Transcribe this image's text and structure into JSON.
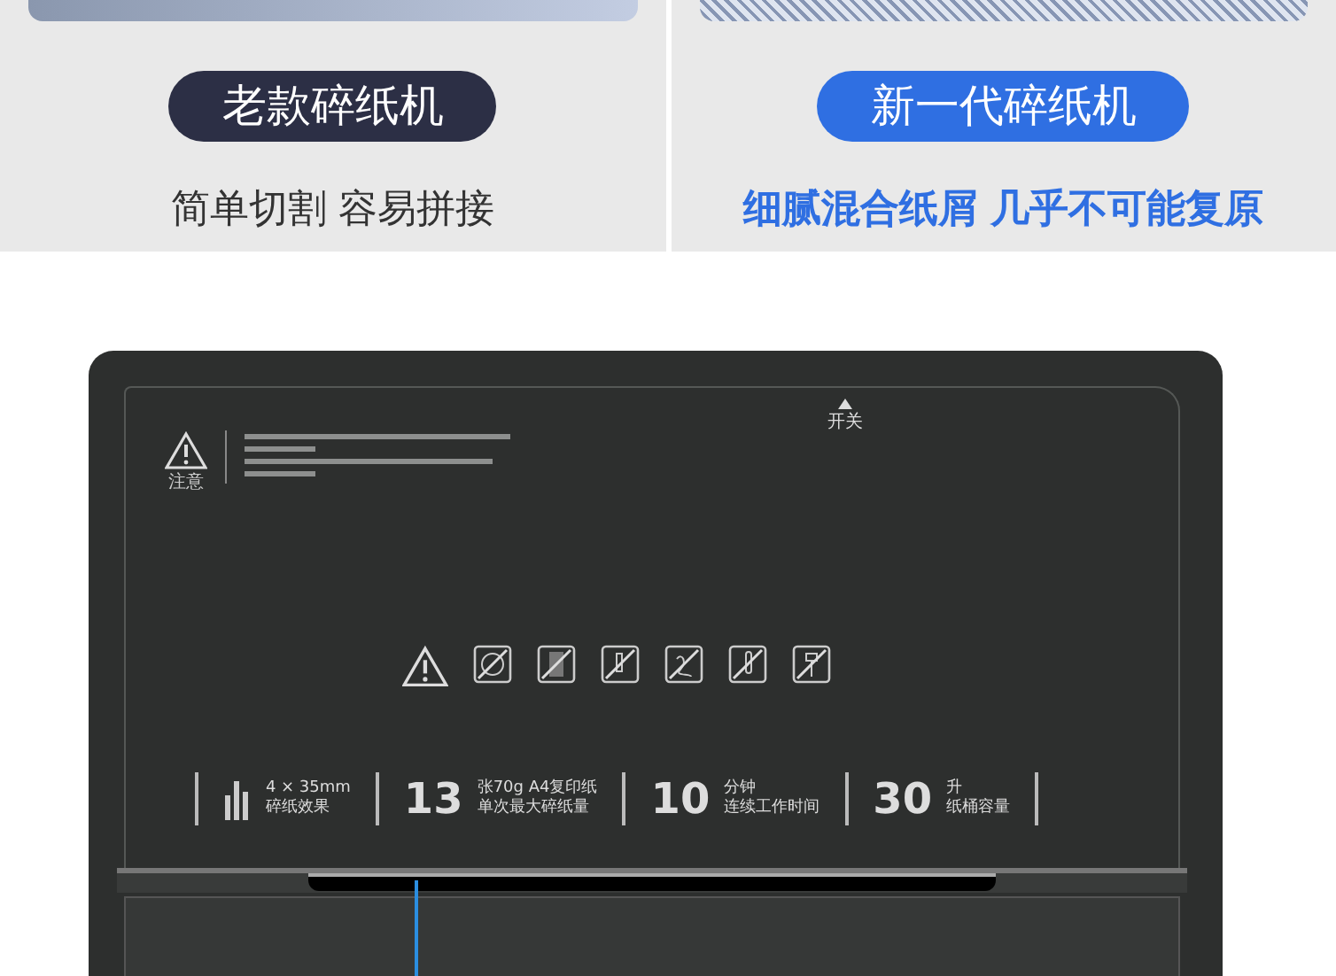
{
  "comparison": [
    {
      "kind": "old",
      "label": "老款碎纸机",
      "caption": "简单切割 容易拼接"
    },
    {
      "kind": "new",
      "label": "新一代碎纸机",
      "caption": "细腻混合纸屑 几乎不可能复原"
    }
  ],
  "shredder": {
    "warning_label": "注意",
    "power_label": "开关",
    "specs": [
      {
        "kind": "icon",
        "lines": [
          "4 × 35mm",
          "碎纸效果"
        ]
      },
      {
        "kind": "number",
        "value": "13",
        "lines": [
          "张70g A4复印纸",
          "单次最大碎纸量"
        ]
      },
      {
        "kind": "number",
        "value": "10",
        "lines": [
          "分钟",
          "连续工作时间"
        ]
      },
      {
        "kind": "number",
        "value": "30",
        "lines": [
          "升",
          "纸桶容量"
        ]
      }
    ]
  }
}
